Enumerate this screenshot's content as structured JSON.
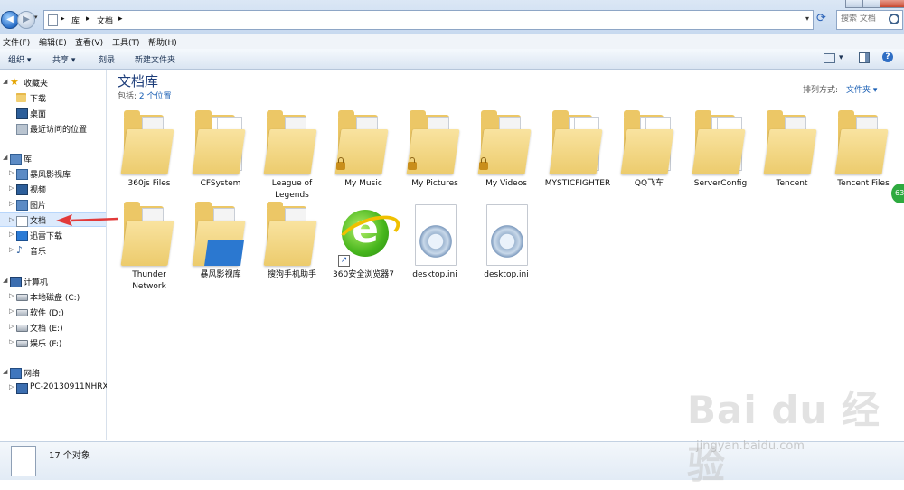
{
  "address": {
    "crumbs": [
      "库",
      "文档"
    ],
    "sep": "▸"
  },
  "search": {
    "placeholder": "搜索 文档"
  },
  "menu": [
    "文件(F)",
    "编辑(E)",
    "查看(V)",
    "工具(T)",
    "帮助(H)"
  ],
  "commands": {
    "organize": "组织 ▾",
    "share": "共享 ▾",
    "burn": "刻录",
    "new_folder": "新建文件夹"
  },
  "nav": {
    "favorites": {
      "label": "收藏夹",
      "items": [
        "下载",
        "桌面",
        "最近访问的位置"
      ]
    },
    "libraries": {
      "label": "库",
      "items": [
        "暴风影视库",
        "视频",
        "图片",
        "文档",
        "迅雷下载",
        "音乐"
      ]
    },
    "computer": {
      "label": "计算机",
      "items": [
        "本地磁盘 (C:)",
        "软件 (D:)",
        "文档 (E:)",
        "娱乐 (F:)"
      ]
    },
    "network": {
      "label": "网络",
      "items": [
        "PC-20130911NHRX"
      ]
    }
  },
  "library": {
    "title": "文档库",
    "includes_prefix": "包括:",
    "includes_link": "2 个位置",
    "arrange_label": "排列方式:",
    "arrange_value": "文件夹 ▾"
  },
  "items": [
    {
      "name": "360js Files",
      "type": "folder"
    },
    {
      "name": "CFSystem",
      "type": "folder-paper"
    },
    {
      "name": "League of Legends",
      "type": "folder"
    },
    {
      "name": "My Music",
      "type": "folder-locked"
    },
    {
      "name": "My Pictures",
      "type": "folder-locked"
    },
    {
      "name": "My Videos",
      "type": "folder-locked"
    },
    {
      "name": "MYSTICFIGHTER",
      "type": "folder-app"
    },
    {
      "name": "QQ飞车",
      "type": "folder-app"
    },
    {
      "name": "ServerConfig",
      "type": "folder-paper"
    },
    {
      "name": "Tencent",
      "type": "folder"
    },
    {
      "name": "Tencent Files",
      "type": "folder"
    },
    {
      "name": "Thunder Network",
      "type": "folder"
    },
    {
      "name": "暴风影视库",
      "type": "folder-blue"
    },
    {
      "name": "搜狗手机助手",
      "type": "folder"
    },
    {
      "name": "360安全浏览器7",
      "type": "shortcut-ie"
    },
    {
      "name": "desktop.ini",
      "type": "ini"
    },
    {
      "name": "desktop.ini",
      "type": "ini"
    }
  ],
  "status": {
    "text": "17 个对象"
  },
  "badge": "63",
  "watermark": {
    "logo": "Bai du 经验",
    "url": "jingyan.baidu.com"
  },
  "colors": {
    "accent": "#1a5fb4",
    "selection": "#dceafc",
    "folder": "#ecc766",
    "arrow": "#e23a3a"
  }
}
